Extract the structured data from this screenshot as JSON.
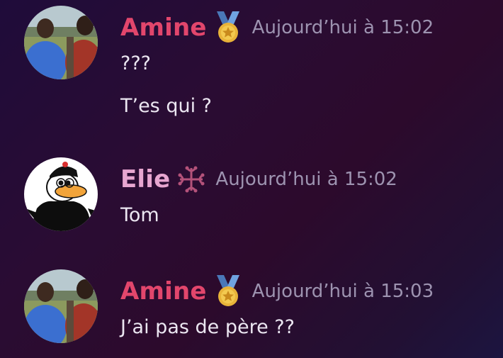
{
  "colors": {
    "amine_name": "#e2466c",
    "elie_name": "#e7a6d0",
    "timestamp": "#9d93b0",
    "text": "#ebe6f1"
  },
  "messages": [
    {
      "author": "Amine",
      "role_icon": "medal-icon",
      "timestamp": "Aujourd’hui à 15:02",
      "lines": [
        "???",
        "T’es qui ?"
      ]
    },
    {
      "author": "Elie",
      "role_icon": "occitan-cross-icon",
      "timestamp": "Aujourd’hui à 15:02",
      "lines": [
        "Tom"
      ]
    },
    {
      "author": "Amine",
      "role_icon": "medal-icon",
      "timestamp": "Aujourd’hui à 15:03",
      "lines": [
        "J’ai pas de père ??"
      ]
    }
  ]
}
